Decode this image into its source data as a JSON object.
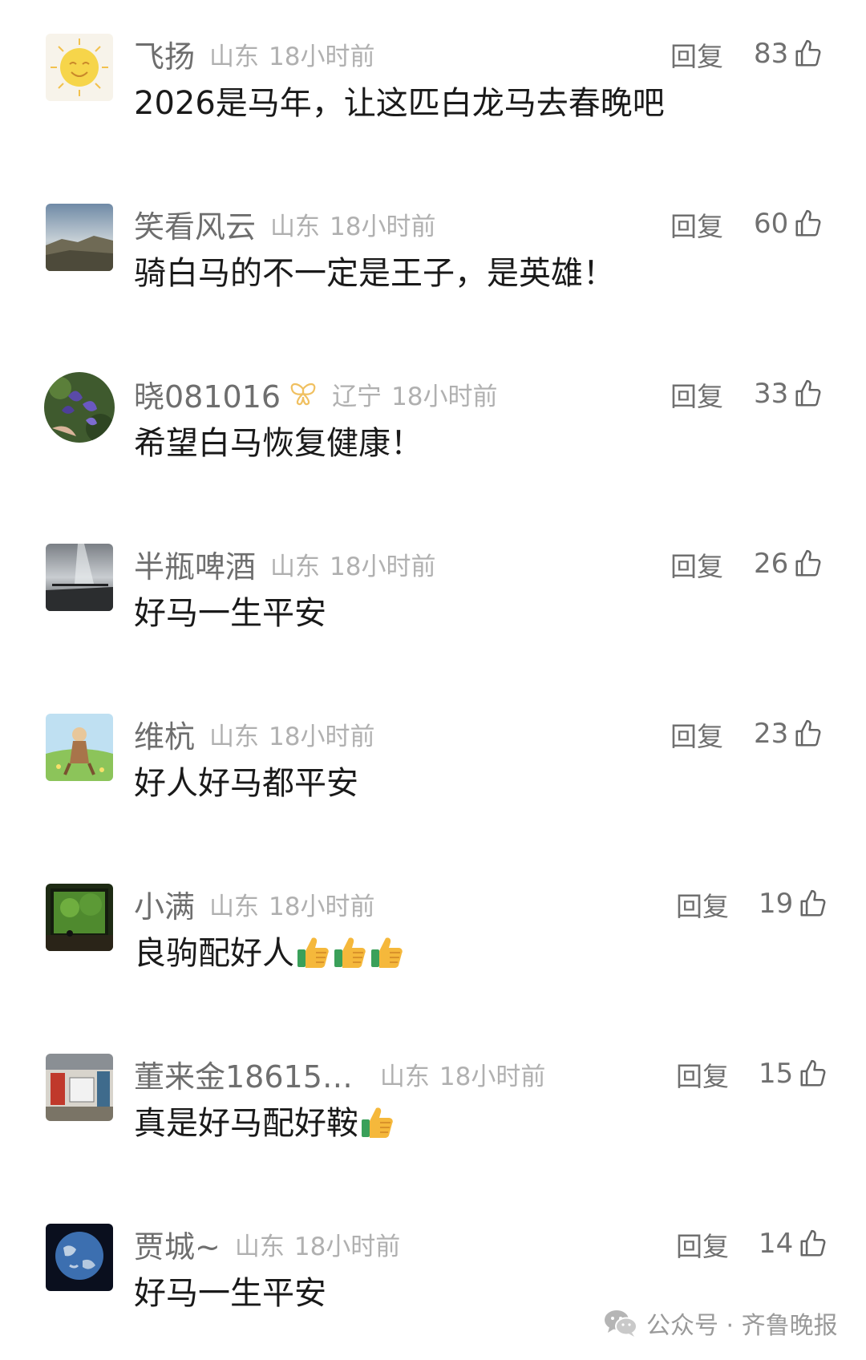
{
  "reply_label": "回复",
  "comments": [
    {
      "username": "飞扬",
      "location": "山东",
      "time": "18小时前",
      "content": "2026是马年，让这匹白龙马去春晚吧",
      "likes": "83"
    },
    {
      "username": "笑看风云",
      "location": "山东",
      "time": "18小时前",
      "content": "骑白马的不一定是王子，是英雄！",
      "likes": "60"
    },
    {
      "username": "晓081016",
      "location": "辽宁",
      "time": "18小时前",
      "content": "希望白马恢复健康！",
      "likes": "33"
    },
    {
      "username": "半瓶啤酒",
      "location": "山东",
      "time": "18小时前",
      "content": "好马一生平安",
      "likes": "26"
    },
    {
      "username": "维杭",
      "location": "山东",
      "time": "18小时前",
      "content": "好人好马都平安",
      "likes": "23"
    },
    {
      "username": "小满",
      "location": "山东",
      "time": "18小时前",
      "content": "良驹配好人",
      "likes": "19"
    },
    {
      "username": "董来金18615…",
      "location": "山东",
      "time": "18小时前",
      "content": "真是好马配好鞍",
      "likes": "15"
    },
    {
      "username": "贾城~",
      "location": "山东",
      "time": "18小时前",
      "content": "好马一生平安",
      "likes": "14"
    }
  ],
  "watermark": {
    "text": "公众号 · 齐鲁晚报",
    "icon": "wechat-icon"
  },
  "icons": {
    "like": "thumbs-up-outline-icon",
    "badge": "butterfly-icon",
    "emoji": "thumbs-up-emoji"
  },
  "colors": {
    "username": "#6e6e6e",
    "meta": "#b0b0b0",
    "content": "#1a1a1a",
    "action": "#707070",
    "badge": "#f0c060"
  }
}
